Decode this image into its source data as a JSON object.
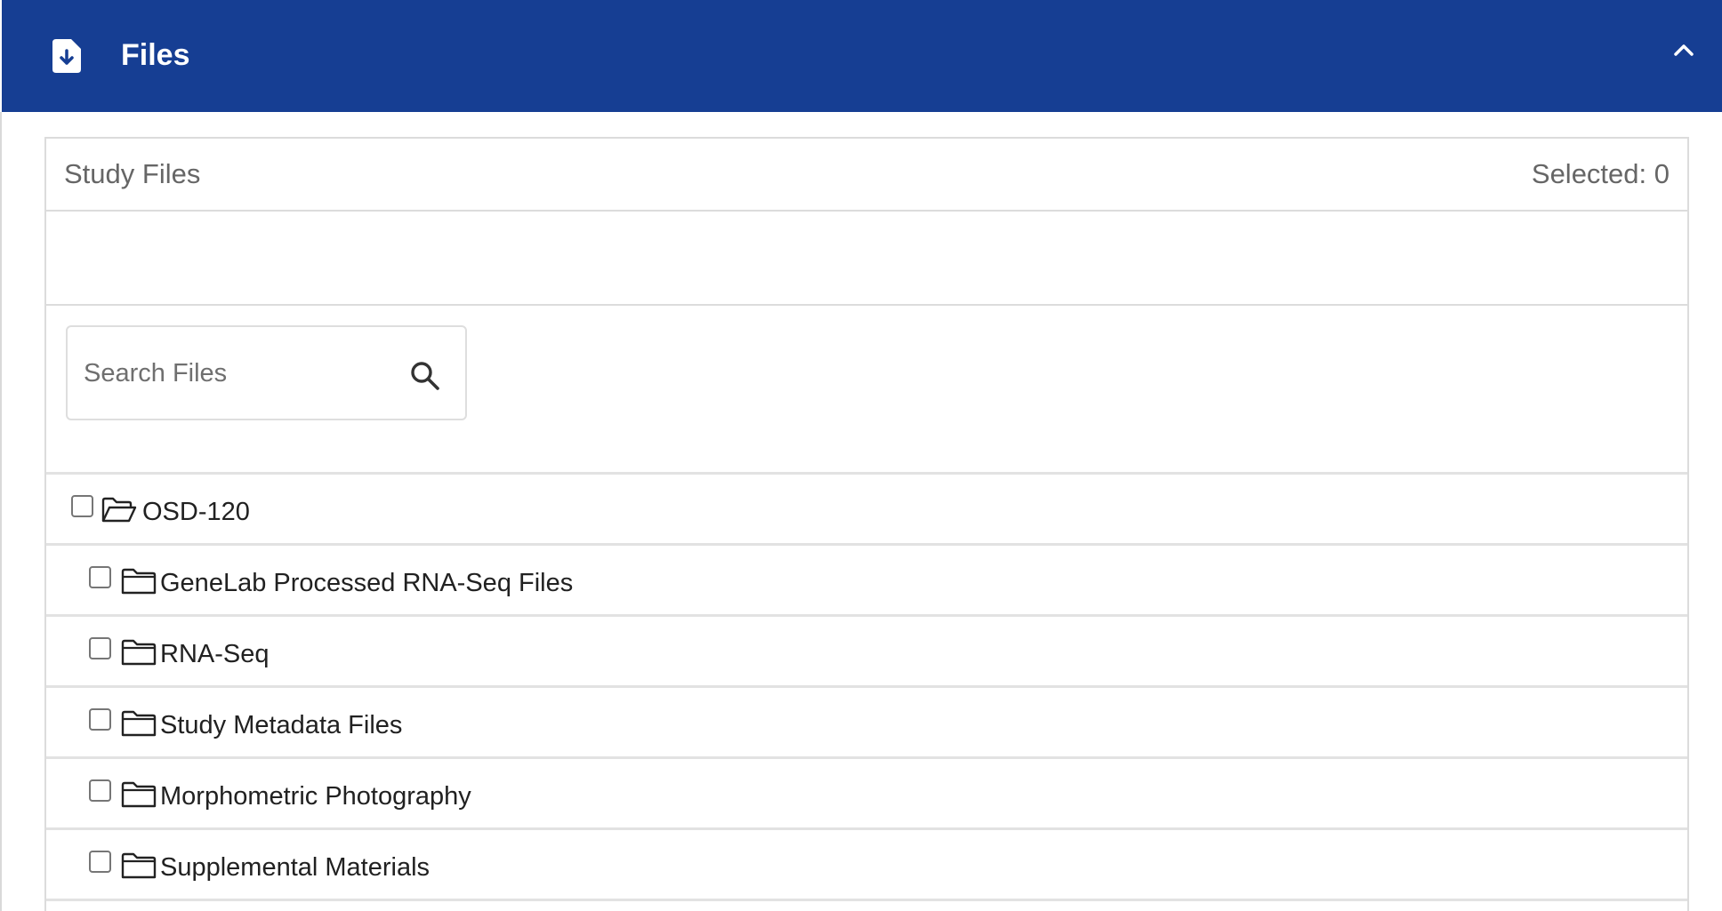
{
  "header": {
    "title": "Files",
    "icon": "file-download-icon",
    "collapse_icon": "chevron-up-icon",
    "background": "#163e93"
  },
  "panel": {
    "label": "Study Files",
    "selected_text": "Selected: 0"
  },
  "search": {
    "placeholder": "Search Files",
    "value": "",
    "icon": "search-icon"
  },
  "tree": {
    "root": {
      "label": "OSD-120",
      "icon": "folder-open-icon",
      "checked": false
    },
    "children": [
      {
        "label": "GeneLab Processed RNA-Seq Files",
        "icon": "folder-icon",
        "checked": false
      },
      {
        "label": "RNA-Seq",
        "icon": "folder-icon",
        "checked": false
      },
      {
        "label": "Study Metadata Files",
        "icon": "folder-icon",
        "checked": false
      },
      {
        "label": "Morphometric Photography",
        "icon": "folder-icon",
        "checked": false
      },
      {
        "label": "Supplemental Materials",
        "icon": "folder-icon",
        "checked": false
      }
    ]
  }
}
